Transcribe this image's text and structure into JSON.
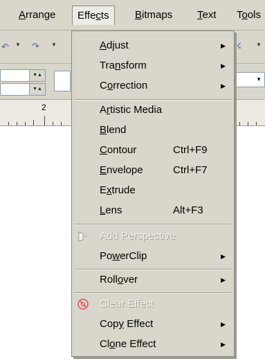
{
  "menubar": {
    "items": [
      {
        "label": "Arrange",
        "mnemonic": "A",
        "rest": "rrange"
      },
      {
        "label": "Effects",
        "pre": "Effe",
        "mnemonic": "c",
        "rest": "ts"
      },
      {
        "label": "Bitmaps",
        "mnemonic": "B",
        "rest": "itmaps"
      },
      {
        "label": "Text",
        "mnemonic": "T",
        "rest": "ext"
      },
      {
        "label": "Tools",
        "pre": "T",
        "mnemonic": "o",
        "rest": "ols"
      }
    ]
  },
  "ruler": {
    "label": "2"
  },
  "effects_menu": {
    "items": [
      {
        "label": "Adjust",
        "pre": "",
        "mnemonic": "A",
        "rest": "djust",
        "submenu": true,
        "enabled": true
      },
      {
        "label": "Transform",
        "pre": "Tra",
        "mnemonic": "n",
        "rest": "sform",
        "submenu": true,
        "enabled": true
      },
      {
        "label": "Correction",
        "pre": "C",
        "mnemonic": "o",
        "rest": "rrection",
        "submenu": true,
        "enabled": true
      },
      {
        "label": "Artistic Media",
        "pre": "A",
        "mnemonic": "r",
        "rest": "tistic Media",
        "enabled": true
      },
      {
        "label": "Blend",
        "pre": "",
        "mnemonic": "B",
        "rest": "lend",
        "enabled": true
      },
      {
        "label": "Contour",
        "pre": "",
        "mnemonic": "C",
        "rest": "ontour",
        "shortcut": "Ctrl+F9",
        "enabled": true
      },
      {
        "label": "Envelope",
        "pre": "",
        "mnemonic": "E",
        "rest": "nvelope",
        "shortcut": "Ctrl+F7",
        "enabled": true
      },
      {
        "label": "Extrude",
        "pre": "E",
        "mnemonic": "x",
        "rest": "trude",
        "enabled": true
      },
      {
        "label": "Lens",
        "pre": "",
        "mnemonic": "L",
        "rest": "ens",
        "shortcut": "Alt+F3",
        "enabled": true
      },
      {
        "label": "Add Perspective",
        "pre": "",
        "mnemonic": "",
        "rest": "Add Perspective",
        "enabled": false,
        "icon": "perspective-icon"
      },
      {
        "label": "PowerClip",
        "pre": "Po",
        "mnemonic": "w",
        "rest": "erClip",
        "submenu": true,
        "enabled": true
      },
      {
        "label": "Rollover",
        "pre": "Roll",
        "mnemonic": "o",
        "rest": "ver",
        "submenu": true,
        "enabled": true
      },
      {
        "label": "Clear Effect",
        "pre": "",
        "mnemonic": "",
        "rest": "Clear Effect",
        "enabled": false,
        "icon": "clear-effect-icon"
      },
      {
        "label": "Copy Effect",
        "pre": "Cop",
        "mnemonic": "y",
        "rest": " Effect",
        "submenu": true,
        "enabled": true
      },
      {
        "label": "Clone Effect",
        "pre": "Cl",
        "mnemonic": "o",
        "rest": "ne Effect",
        "submenu": true,
        "enabled": true
      }
    ]
  },
  "colors": {
    "menu_bg": "#d9d6cb",
    "disabled_text": "#f3f2ee",
    "clear_icon": "#d9535b"
  }
}
